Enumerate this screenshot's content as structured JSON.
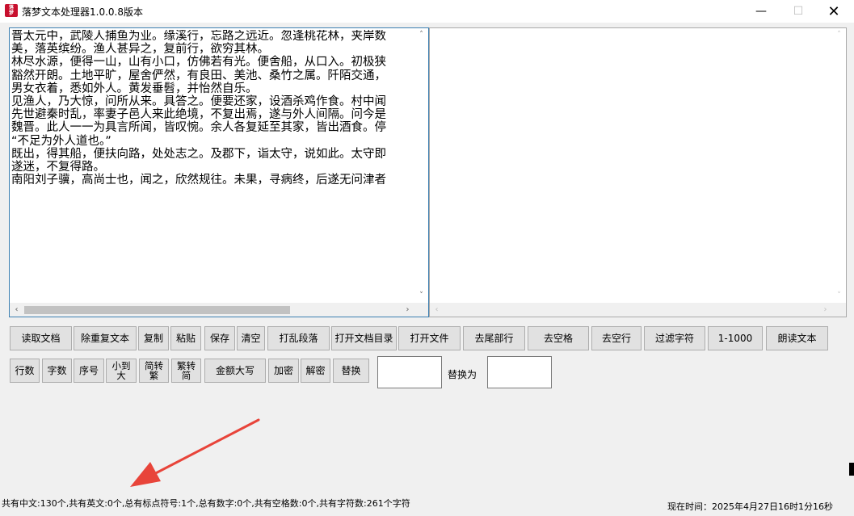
{
  "window": {
    "icon_text": "落梦",
    "title": "落梦文本处理器1.0.0.8版本",
    "minimize": "—",
    "maximize": "☐",
    "close": "✕"
  },
  "editor_left": {
    "text": "晋太元中，武陵人捕鱼为业。缘溪行，忘路之远近。忽逢桃花林，夹岸数\n美，落英缤纷。渔人甚异之，复前行，欲穷其林。\n林尽水源，便得一山，山有小口，仿佛若有光。便舍船，从口入。初极狭\n豁然开朗。土地平旷，屋舍俨然，有良田、美池、桑竹之属。阡陌交通，\n男女衣着，悉如外人。黄发垂髫，并怡然自乐。\n见渔人，乃大惊，问所从来。具答之。便要还家，设酒杀鸡作食。村中闻\n先世避秦时乱，率妻子邑人来此绝境，不复出焉，遂与外人间隔。问今是\n魏晋。此人一一为具言所闻，皆叹惋。余人各复延至其家，皆出酒食。停\n“不足为外人道也。”\n既出，得其船，便扶向路，处处志之。及郡下，诣太守，说如此。太守即\n遂迷，不复得路。\n南阳刘子骥，高尚士也，闻之，欣然规往。未果，寻病终，后遂无问津者",
    "scroll_up": "˄",
    "scroll_down": "˅",
    "scroll_left": "‹",
    "scroll_right": "›"
  },
  "editor_right": {
    "text": "",
    "scroll_up": "˄",
    "scroll_down": "˅",
    "scroll_left": "‹",
    "scroll_right": "›"
  },
  "toolbar_row1": [
    {
      "label": "读取文档"
    },
    {
      "label": "除重复文本"
    },
    {
      "label": "复制"
    },
    {
      "label": "粘贴"
    },
    {
      "label": "保存"
    },
    {
      "label": "清空"
    },
    {
      "label": "打乱段落"
    },
    {
      "label": "打开文档目录"
    },
    {
      "label": "打开文件"
    },
    {
      "label": "去尾部行"
    },
    {
      "label": "去空格"
    },
    {
      "label": "去空行"
    },
    {
      "label": "过滤字符"
    },
    {
      "label": "1-1000"
    },
    {
      "label": "朗读文本"
    }
  ],
  "toolbar_row2": [
    {
      "label": "行数"
    },
    {
      "label": "字数"
    },
    {
      "label": "序号"
    },
    {
      "label": "小到大"
    },
    {
      "label": "简转繁"
    },
    {
      "label": "繁转简"
    },
    {
      "label": "金额大写"
    },
    {
      "label": "加密"
    },
    {
      "label": "解密"
    },
    {
      "label": "替换"
    }
  ],
  "replace": {
    "find_value": "",
    "label": "替换为",
    "replace_value": ""
  },
  "status": {
    "stats": "共有中文:130个,共有英文:0个,总有标点符号:1个,总有数字:0个,共有空格数:0个,共有字符数:261个字符",
    "time": "现在时间：2025年4月27日16时1分16秒"
  },
  "colors": {
    "annotation_arrow": "#e8443a",
    "focus_border": "#3c7fb1"
  }
}
